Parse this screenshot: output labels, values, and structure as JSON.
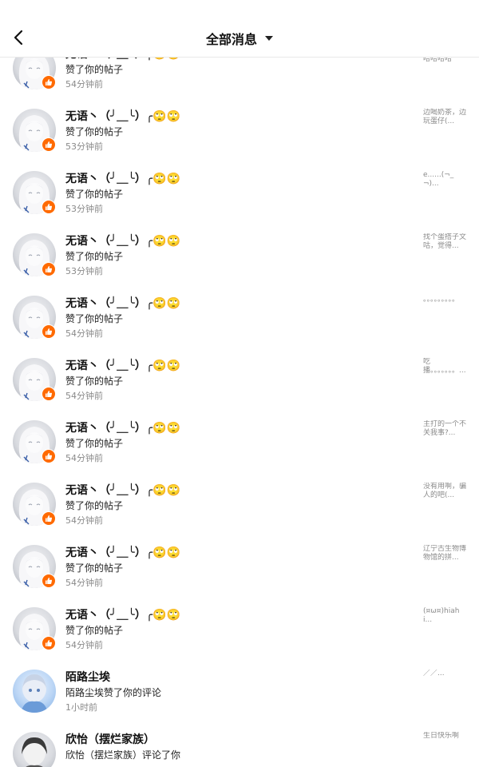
{
  "header": {
    "title": "全部消息"
  },
  "notifications": [
    {
      "name": "无语丶（╯＿╰）╭🙄🙄",
      "action": "赞了你的帖子",
      "time": "54分钟前",
      "preview": "小红唱交响乐哈哈哈哈",
      "avatar": "girl-white-hair",
      "badge": "like"
    },
    {
      "name": "无语丶（╯＿╰）╭🙄🙄",
      "action": "赞了你的帖子",
      "time": "53分钟前",
      "preview": "边喝奶茶，边玩蛋仔(...",
      "avatar": "girl-white-hair",
      "badge": "like"
    },
    {
      "name": "无语丶（╯＿╰）╭🙄🙄",
      "action": "赞了你的帖子",
      "time": "53分钟前",
      "preview": "e......(¬_¬)...",
      "avatar": "girl-white-hair",
      "badge": "like"
    },
    {
      "name": "无语丶（╯＿╰）╭🙄🙄",
      "action": "赞了你的帖子",
      "time": "53分钟前",
      "preview": "找个蛋搭子文咕，觉得...",
      "avatar": "girl-white-hair",
      "badge": "like"
    },
    {
      "name": "无语丶（╯＿╰）╭🙄🙄",
      "action": "赞了你的帖子",
      "time": "54分钟前",
      "preview": "。。。。。。。。。",
      "avatar": "girl-white-hair",
      "badge": "like"
    },
    {
      "name": "无语丶（╯＿╰）╭🙄🙄",
      "action": "赞了你的帖子",
      "time": "54分钟前",
      "preview": "吃播。。。。。。。...",
      "avatar": "girl-white-hair",
      "badge": "like"
    },
    {
      "name": "无语丶（╯＿╰）╭🙄🙄",
      "action": "赞了你的帖子",
      "time": "54分钟前",
      "preview": "主打的一个不关我事?...",
      "avatar": "girl-white-hair",
      "badge": "like"
    },
    {
      "name": "无语丶（╯＿╰）╭🙄🙄",
      "action": "赞了你的帖子",
      "time": "54分钟前",
      "preview": "没有用啊，骗人的吧(...",
      "avatar": "girl-white-hair",
      "badge": "like"
    },
    {
      "name": "无语丶（╯＿╰）╭🙄🙄",
      "action": "赞了你的帖子",
      "time": "54分钟前",
      "preview": "辽宁古生物博物馆的拼...",
      "avatar": "girl-white-hair",
      "badge": "like"
    },
    {
      "name": "无语丶（╯＿╰）╭🙄🙄",
      "action": "赞了你的帖子",
      "time": "54分钟前",
      "preview": "(¤ω¤)hiahi...",
      "avatar": "girl-white-hair",
      "badge": "like"
    },
    {
      "name": "陌路尘埃",
      "action": "陌路尘埃赞了你的评论",
      "time": "1小时前",
      "preview": "／／...",
      "avatar": "girl-blue",
      "badge": ""
    },
    {
      "name": "欣怡（摆烂家族）",
      "action": "欣怡（摆烂家族）评论了你",
      "time": "",
      "preview": "生日快乐啊",
      "avatar": "girl-dark",
      "badge": ""
    }
  ],
  "colors": {
    "like_badge": "#ff6a00",
    "time_text": "#8a8a8a"
  },
  "icons": {
    "back": "chevron-left-icon",
    "dropdown": "caret-down-icon",
    "like": "thumbs-up-icon"
  }
}
